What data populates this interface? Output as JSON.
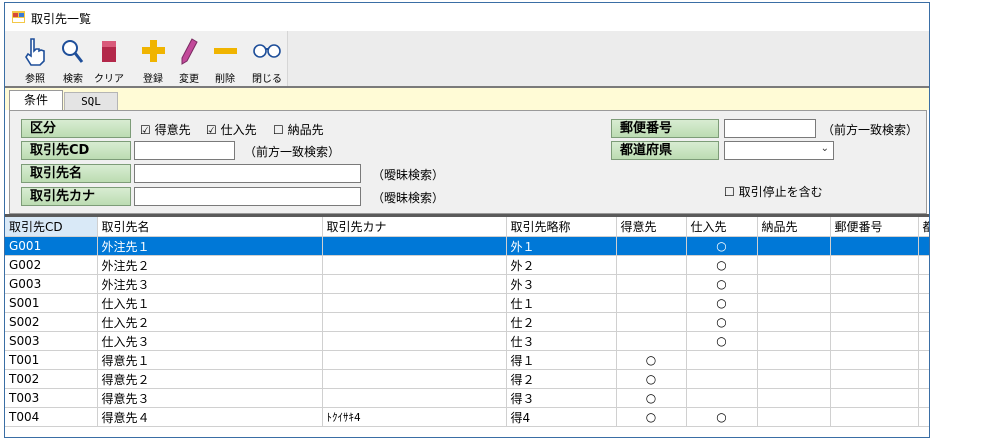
{
  "window": {
    "title": "取引先一覧"
  },
  "toolbar": [
    {
      "label": "参照",
      "icon": "hand-pointer-icon"
    },
    {
      "label": "検索",
      "icon": "magnifier-icon"
    },
    {
      "label": "クリア",
      "icon": "eraser-icon"
    },
    {
      "label": "登録",
      "icon": "plus-icon"
    },
    {
      "label": "変更",
      "icon": "pencil-icon"
    },
    {
      "label": "削除",
      "icon": "minus-icon"
    },
    {
      "label": "閉じる",
      "icon": "binoculars-icon"
    }
  ],
  "tabs": [
    {
      "label": "条件"
    },
    {
      "label": "SQL"
    }
  ],
  "conditions": {
    "kubun_label": "区分",
    "check_customer": "☑ 得意先",
    "check_supplier": "☑ 仕入先",
    "check_delivery": "☐ 納品先",
    "cd_label": "取引先CD",
    "cd_value": "",
    "cd_hint": "（前方一致検索）",
    "name_label": "取引先名",
    "name_value": "",
    "name_hint": "（曖昧検索）",
    "kana_label": "取引先カナ",
    "kana_value": "",
    "kana_hint": "（曖昧検索）",
    "zip_label": "郵便番号",
    "zip_value": "",
    "zip_hint": "（前方一致検索）",
    "pref_label": "都道府県",
    "pref_value": "",
    "include_stopped": "☐ 取引停止を含む"
  },
  "grid": {
    "columns": [
      "取引先CD",
      "取引先名",
      "取引先カナ",
      "取引先略称",
      "得意先",
      "仕入先",
      "納品先",
      "郵便番号",
      "都"
    ],
    "rows": [
      {
        "cd": "G001",
        "name": "外注先１",
        "kana": "",
        "abbr": "外１",
        "cust": "",
        "supp": "○",
        "deli": "",
        "zip": "",
        "pref": ""
      },
      {
        "cd": "G002",
        "name": "外注先２",
        "kana": "",
        "abbr": "外２",
        "cust": "",
        "supp": "○",
        "deli": "",
        "zip": "",
        "pref": ""
      },
      {
        "cd": "G003",
        "name": "外注先３",
        "kana": "",
        "abbr": "外３",
        "cust": "",
        "supp": "○",
        "deli": "",
        "zip": "",
        "pref": ""
      },
      {
        "cd": "S001",
        "name": "仕入先１",
        "kana": "",
        "abbr": "仕１",
        "cust": "",
        "supp": "○",
        "deli": "",
        "zip": "",
        "pref": ""
      },
      {
        "cd": "S002",
        "name": "仕入先２",
        "kana": "",
        "abbr": "仕２",
        "cust": "",
        "supp": "○",
        "deli": "",
        "zip": "",
        "pref": ""
      },
      {
        "cd": "S003",
        "name": "仕入先３",
        "kana": "",
        "abbr": "仕３",
        "cust": "",
        "supp": "○",
        "deli": "",
        "zip": "",
        "pref": ""
      },
      {
        "cd": "T001",
        "name": "得意先１",
        "kana": "",
        "abbr": "得１",
        "cust": "○",
        "supp": "",
        "deli": "",
        "zip": "",
        "pref": ""
      },
      {
        "cd": "T002",
        "name": "得意先２",
        "kana": "",
        "abbr": "得２",
        "cust": "○",
        "supp": "",
        "deli": "",
        "zip": "",
        "pref": ""
      },
      {
        "cd": "T003",
        "name": "得意先３",
        "kana": "",
        "abbr": "得３",
        "cust": "○",
        "supp": "",
        "deli": "",
        "zip": "",
        "pref": ""
      },
      {
        "cd": "T004",
        "name": "得意先４",
        "kana": "ﾄｸｲｻｷ4",
        "abbr": "得4",
        "cust": "○",
        "supp": "○",
        "deli": "",
        "zip": "",
        "pref": ""
      }
    ],
    "selected_row": 0
  },
  "colors": {
    "selection": "#0078d7",
    "label_green": "#c8e4c0",
    "tab_strip": "#fffbd6"
  }
}
